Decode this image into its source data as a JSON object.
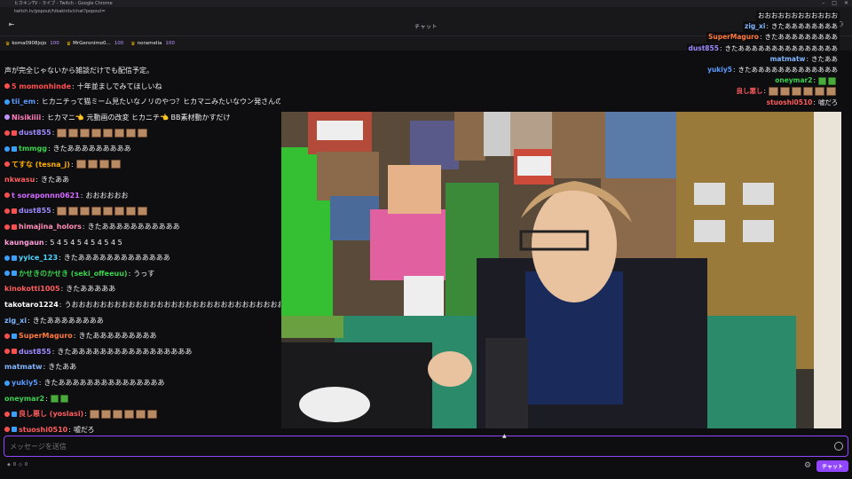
{
  "window": {
    "title": "ヒカキンTV - ライブ - Twitch - Google Chrome",
    "url": "twitch.tv/popout/hikakintv/chat?popout="
  },
  "header": {
    "title": "チャット"
  },
  "bits": [
    {
      "user": "koma0908jojo",
      "amount": "100"
    },
    {
      "user": "MrGeronimo0...",
      "amount": "100"
    },
    {
      "user": "noramelia",
      "amount": "100"
    }
  ],
  "chat": {
    "messages": [
      {
        "user": "",
        "text": "声が完全じゃないから雑談だけでも配信予定。",
        "color": "#efeff1",
        "emotes": 0,
        "badges": []
      },
      {
        "user": "5 momonhinde",
        "text": "十年並ましでみてほしいね",
        "color": "#ff4e4e",
        "emotes": 0,
        "badges": [
          "#ff4e4e"
        ]
      },
      {
        "user": "tii_em",
        "text": "ヒカニチって猫ミーム見たいなノリのやつ？ヒカマニみたいなウン発さんの動画みたいなノリの方が好きなんだけど",
        "color": "#5b9bff",
        "emotes": 0,
        "badges": [
          "#3aa0ff"
        ]
      },
      {
        "user": "Nisikiiii",
        "text": "ヒカマニ👈 元動画の改変 ヒカニチ👈 BB素材動かすだけ",
        "color": "#ff7ebe",
        "emotes": 0,
        "badges": [
          "#bf94ff"
        ]
      },
      {
        "user": "dust855",
        "text": "",
        "color": "#9e8cff",
        "emotes": 8,
        "badges": [
          "#ff4e4e",
          "#ff4e4e"
        ]
      },
      {
        "user": "tmmgg",
        "text": "きたあああああああああ",
        "color": "#3ad24e",
        "emotes": 0,
        "badges": [
          "#3aa0ff",
          "#3aa0ff"
        ]
      },
      {
        "user": "てすな (tesna_j)",
        "text": "",
        "color": "#ffb000",
        "emotes": 4,
        "badges": [
          "#ff4e4e"
        ]
      },
      {
        "user": "nkwasu",
        "text": "きたああ",
        "color": "#ff5d5d",
        "emotes": 0,
        "badges": []
      },
      {
        "user": "t soraponnn0621",
        "text": "おおおおおお",
        "color": "#d36bff",
        "emotes": 0,
        "badges": [
          "#ff4e4e"
        ]
      },
      {
        "user": "dust855",
        "text": "",
        "color": "#9e8cff",
        "emotes": 8,
        "badges": [
          "#ff4e4e",
          "#ff4e4e"
        ]
      },
      {
        "user": "himajina_holors",
        "text": "きたあああああああああああ",
        "color": "#ff8eb4",
        "emotes": 0,
        "badges": [
          "#ff4e4e",
          "#ff4e4e"
        ]
      },
      {
        "user": "kaungaun",
        "text": "5 4 5 4 5 4 5 4 5 4 5",
        "color": "#ff9ed8",
        "emotes": 0,
        "badges": []
      },
      {
        "user": "yyice_123",
        "text": "きたあああああああああああああ",
        "color": "#4ed6ff",
        "emotes": 0,
        "badges": [
          "#3aa0ff",
          "#3aa0ff"
        ]
      },
      {
        "user": "かせきのかせき (seki_offeeuu)",
        "text": "うっす",
        "color": "#3ad24e",
        "emotes": 0,
        "badges": [
          "#3aa0ff",
          "#3aa0ff"
        ]
      },
      {
        "user": "kinokotti1005",
        "text": "きたあああああ",
        "color": "#ff5d5d",
        "emotes": 0,
        "badges": []
      },
      {
        "user": "takotaro1224",
        "text": "うおおおおおおおおおおおおおおおおおおおおおおおおおおおおおおおおおおおおおおおおお",
        "color": "#ffffff",
        "emotes": 0,
        "badges": []
      },
      {
        "user": "zig_xi",
        "text": "きたああああああああ",
        "color": "#7fb6ff",
        "emotes": 0,
        "badges": []
      },
      {
        "user": "SuperMaguro",
        "text": "きたあああああああああ",
        "color": "#ff7a3d",
        "emotes": 0,
        "badges": [
          "#ff4e4e",
          "#3aa0ff"
        ]
      },
      {
        "user": "dust855",
        "text": "きたあああああああああああああああああ",
        "color": "#9e8cff",
        "emotes": 0,
        "badges": [
          "#ff4e4e",
          "#ff4e4e"
        ]
      },
      {
        "user": "matmatw",
        "text": "きたああ",
        "color": "#7fb6ff",
        "emotes": 0,
        "badges": []
      },
      {
        "user": "yukiy5",
        "text": "きたあああああああああああああああ",
        "color": "#5b9bff",
        "emotes": 0,
        "badges": [
          "#3aa0ff"
        ]
      },
      {
        "user": "oneymar2",
        "text": "",
        "color": "#3ad24e",
        "emotes": 2,
        "badges": []
      },
      {
        "user": "良し悪し (yoslasi)",
        "text": "",
        "color": "#ff5d5d",
        "emotes": 6,
        "badges": [
          "#ff4e4e",
          "#3aa0ff"
        ]
      },
      {
        "user": "stuoshi0510",
        "text": "嘘だろ",
        "color": "#ff5d5d",
        "emotes": 0,
        "badges": [
          "#ff4e4e",
          "#3aa0ff"
        ]
      }
    ]
  },
  "overlay": {
    "messages": [
      {
        "user": "",
        "text": "おおおおおおおおおおおお",
        "color": "#efeff1",
        "emotes": 0
      },
      {
        "user": "zig_xi",
        "text": "きたああああああああ",
        "color": "#7fb6ff",
        "emotes": 0
      },
      {
        "user": "SuperMaguro",
        "text": "きたあああああああああ",
        "color": "#ff7a3d",
        "emotes": 0
      },
      {
        "user": "dust855",
        "text": "きたあああああああああああああああ",
        "color": "#9e8cff",
        "emotes": 0
      },
      {
        "user": "matmatw",
        "text": "きたああ",
        "color": "#7fb6ff",
        "emotes": 0
      },
      {
        "user": "yukiy5",
        "text": "きたあああああああああああああ",
        "color": "#5b9bff",
        "emotes": 0
      },
      {
        "user": "oneymar2",
        "text": "",
        "color": "#3ad24e",
        "emotes": 2
      },
      {
        "user": "良し悪し",
        "text": "",
        "color": "#ff5d5d",
        "emotes": 6
      },
      {
        "user": "stuoshi0510",
        "text": "嘘だろ",
        "color": "#ff5d5d",
        "emotes": 0
      }
    ]
  },
  "input": {
    "placeholder": "メッセージを送信"
  },
  "footer": {
    "points": "0",
    "points2": "0",
    "chat_label": "チャット"
  },
  "colors": {
    "accent": "#9147ff",
    "background": "#0e0e10"
  }
}
